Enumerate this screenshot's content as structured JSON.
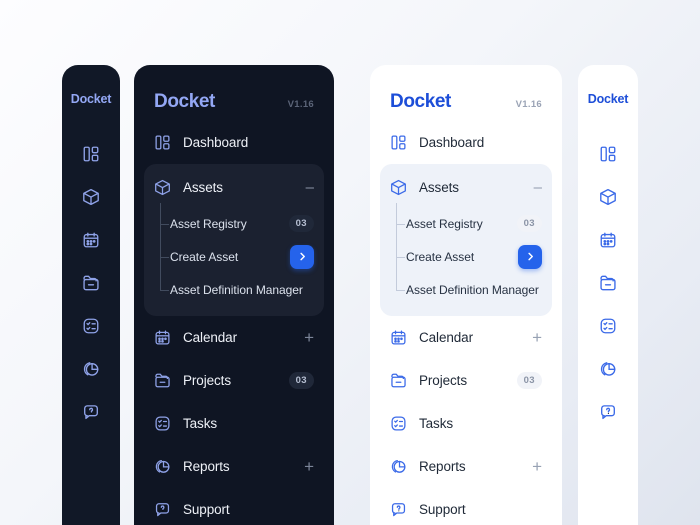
{
  "app": {
    "brand": "Docket",
    "version": "V1.16"
  },
  "nav": {
    "dashboard": {
      "label": "Dashboard",
      "icon": "dashboard-icon"
    },
    "assets": {
      "label": "Assets",
      "icon": "cube-icon",
      "collapse_glyph": "–",
      "children": [
        {
          "label": "Asset Registry",
          "badge": "03",
          "action": ""
        },
        {
          "label": "Create Asset",
          "badge": "",
          "action": "chevron-right"
        },
        {
          "label": "Asset Definition Manager",
          "badge": "",
          "action": ""
        }
      ]
    },
    "calendar": {
      "label": "Calendar",
      "icon": "calendar-icon",
      "add_glyph": "+"
    },
    "projects": {
      "label": "Projects",
      "icon": "folder-icon",
      "badge": "03"
    },
    "tasks": {
      "label": "Tasks",
      "icon": "checklist-icon"
    },
    "reports": {
      "label": "Reports",
      "icon": "pie-chart-icon",
      "add_glyph": "+"
    },
    "support": {
      "label": "Support",
      "icon": "help-bubble-icon"
    }
  },
  "rail_icons": [
    "dashboard-icon",
    "cube-icon",
    "calendar-icon",
    "folder-icon",
    "checklist-icon",
    "pie-chart-icon",
    "help-bubble-icon"
  ],
  "colors": {
    "accent": "#2563eb",
    "brand_light": "#1d4ed8",
    "brand_dark": "#93a7f4",
    "panel_dark": "#111827",
    "panel_dark_alt": "#0f1523",
    "panel_light": "#ffffff",
    "group_dark": "#1b2130",
    "group_light": "#eef2f9"
  }
}
